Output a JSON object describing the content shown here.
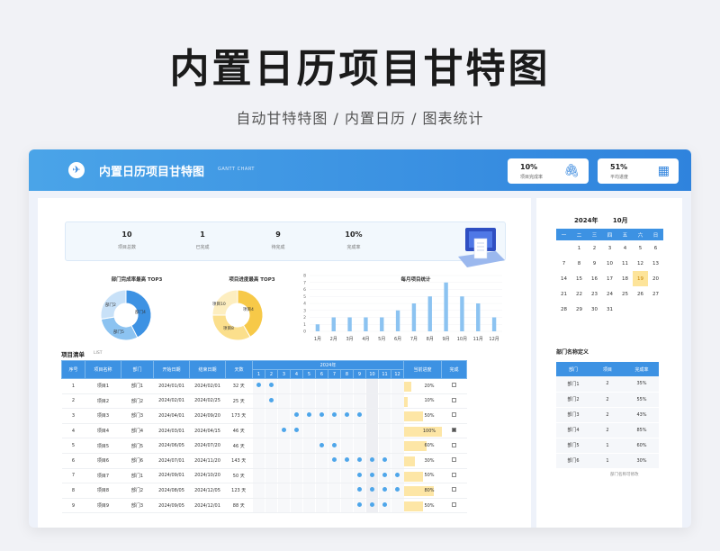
{
  "hero": {
    "title": "内置日历项目甘特图",
    "subtitle": "自动甘特特图 / 内置日历 / 图表统计"
  },
  "header": {
    "app_title": "内置日历项目甘特图",
    "app_subtitle": "GANTT CHART",
    "logo_icon": "rocket-icon",
    "stats": [
      {
        "value": "10%",
        "label": "项目完成率",
        "icon": "paperclip-icon"
      },
      {
        "value": "51%",
        "label": "平均进度",
        "icon": "calculator-icon"
      }
    ]
  },
  "summary": [
    {
      "value": "10",
      "label": "项目总数"
    },
    {
      "value": "1",
      "label": "已完成"
    },
    {
      "value": "9",
      "label": "待完成"
    },
    {
      "value": "10%",
      "label": "完成率"
    }
  ],
  "charts": {
    "dept_title": "部门完成率最高 TOP3",
    "proj_title": "项目进度最高 TOP3",
    "month_title": "每月项目统计",
    "dept_labels": [
      "部门2",
      "部门4",
      "部门5"
    ],
    "proj_labels": [
      "项目10",
      "项目4",
      "项目8"
    ]
  },
  "chart_data": [
    {
      "type": "pie",
      "title": "部门完成率最高 TOP3",
      "categories": [
        "部门4",
        "部门5",
        "部门2"
      ],
      "values": [
        85,
        60,
        55
      ],
      "colors": [
        "#3d92e3",
        "#8cc3f1",
        "#c8e1f8"
      ]
    },
    {
      "type": "pie",
      "title": "项目进度最高 TOP3",
      "categories": [
        "项目4",
        "项目8",
        "项目10"
      ],
      "values": [
        100,
        80,
        60
      ],
      "colors": [
        "#f7c948",
        "#fbdf8c",
        "#fdeec0"
      ]
    },
    {
      "type": "bar",
      "title": "每月项目统计",
      "categories": [
        "1月",
        "2月",
        "3月",
        "4月",
        "5月",
        "6月",
        "7月",
        "8月",
        "9月",
        "10月",
        "11月",
        "12月"
      ],
      "values": [
        1,
        2,
        2,
        2,
        2,
        3,
        4,
        5,
        7,
        5,
        4,
        2
      ],
      "yticks": [
        0,
        1,
        2,
        3,
        4,
        5,
        6,
        7,
        8
      ],
      "ylim": [
        0,
        8
      ],
      "color": "#8cc3f1"
    }
  ],
  "gantt": {
    "section_title": "项目清单",
    "section_sub": "LIST",
    "year_label": "2024年",
    "columns": [
      "序号",
      "项目名称",
      "部门",
      "开始日期",
      "结束日期",
      "天数"
    ],
    "month_cols": [
      "1",
      "2",
      "3",
      "4",
      "5",
      "6",
      "7",
      "8",
      "9",
      "10",
      "11",
      "12"
    ],
    "progress_col": "当前进度",
    "done_col": "完成",
    "highlight_month": 10,
    "rows": [
      {
        "no": "1",
        "name": "项目1",
        "dept": "部门1",
        "start": "2024/01/01",
        "end": "2024/02/01",
        "days": "32 天",
        "months": [
          1,
          2
        ],
        "progress": "20%",
        "p": 20,
        "done": false
      },
      {
        "no": "2",
        "name": "项目2",
        "dept": "部门2",
        "start": "2024/02/01",
        "end": "2024/02/25",
        "days": "25 天",
        "months": [
          2
        ],
        "progress": "10%",
        "p": 10,
        "done": false
      },
      {
        "no": "3",
        "name": "项目3",
        "dept": "部门3",
        "start": "2024/04/01",
        "end": "2024/09/20",
        "days": "173 天",
        "months": [
          4,
          5,
          6,
          7,
          8,
          9
        ],
        "progress": "50%",
        "p": 50,
        "done": false
      },
      {
        "no": "4",
        "name": "项目4",
        "dept": "部门4",
        "start": "2024/03/01",
        "end": "2024/04/15",
        "days": "46 天",
        "months": [
          3,
          4
        ],
        "progress": "100%",
        "p": 100,
        "done": true
      },
      {
        "no": "5",
        "name": "项目5",
        "dept": "部门5",
        "start": "2024/06/05",
        "end": "2024/07/20",
        "days": "46 天",
        "months": [
          6,
          7
        ],
        "progress": "60%",
        "p": 60,
        "done": false
      },
      {
        "no": "6",
        "name": "项目6",
        "dept": "部门6",
        "start": "2024/07/01",
        "end": "2024/11/20",
        "days": "143 天",
        "months": [
          7,
          8,
          9,
          10,
          11
        ],
        "progress": "30%",
        "p": 30,
        "done": false
      },
      {
        "no": "7",
        "name": "项目7",
        "dept": "部门1",
        "start": "2024/09/01",
        "end": "2024/10/20",
        "days": "50 天",
        "months": [
          9,
          10,
          11,
          12
        ],
        "progress": "50%",
        "p": 50,
        "done": false
      },
      {
        "no": "8",
        "name": "项目8",
        "dept": "部门2",
        "start": "2024/08/05",
        "end": "2024/12/05",
        "days": "123 天",
        "months": [
          9,
          10,
          11,
          12
        ],
        "progress": "80%",
        "p": 80,
        "done": false
      },
      {
        "no": "9",
        "name": "项目9",
        "dept": "部门3",
        "start": "2024/09/05",
        "end": "2024/12/01",
        "days": "88 天",
        "months": [
          9,
          10,
          11
        ],
        "progress": "50%",
        "p": 50,
        "done": false
      }
    ]
  },
  "calendar": {
    "year": "2024年",
    "month": "10月",
    "weekdays": [
      "一",
      "二",
      "三",
      "四",
      "五",
      "六",
      "日"
    ],
    "weeks": [
      [
        "",
        "1",
        "2",
        "3",
        "4",
        "5",
        "6"
      ],
      [
        "7",
        "8",
        "9",
        "10",
        "11",
        "12",
        "13"
      ],
      [
        "14",
        "15",
        "16",
        "17",
        "18",
        "19",
        "20"
      ],
      [
        "21",
        "22",
        "23",
        "24",
        "25",
        "26",
        "27"
      ],
      [
        "28",
        "29",
        "30",
        "31",
        "",
        "",
        ""
      ]
    ],
    "today": "19"
  },
  "dept_table": {
    "title": "部门名称定义",
    "columns": [
      "部门",
      "项目",
      "完成率"
    ],
    "rows": [
      [
        "部门1",
        "2",
        "35%"
      ],
      [
        "部门2",
        "2",
        "55%"
      ],
      [
        "部门3",
        "2",
        "43%"
      ],
      [
        "部门4",
        "2",
        "85%"
      ],
      [
        "部门5",
        "1",
        "60%"
      ],
      [
        "部门6",
        "1",
        "30%"
      ]
    ],
    "note": "部门名称可修改"
  }
}
